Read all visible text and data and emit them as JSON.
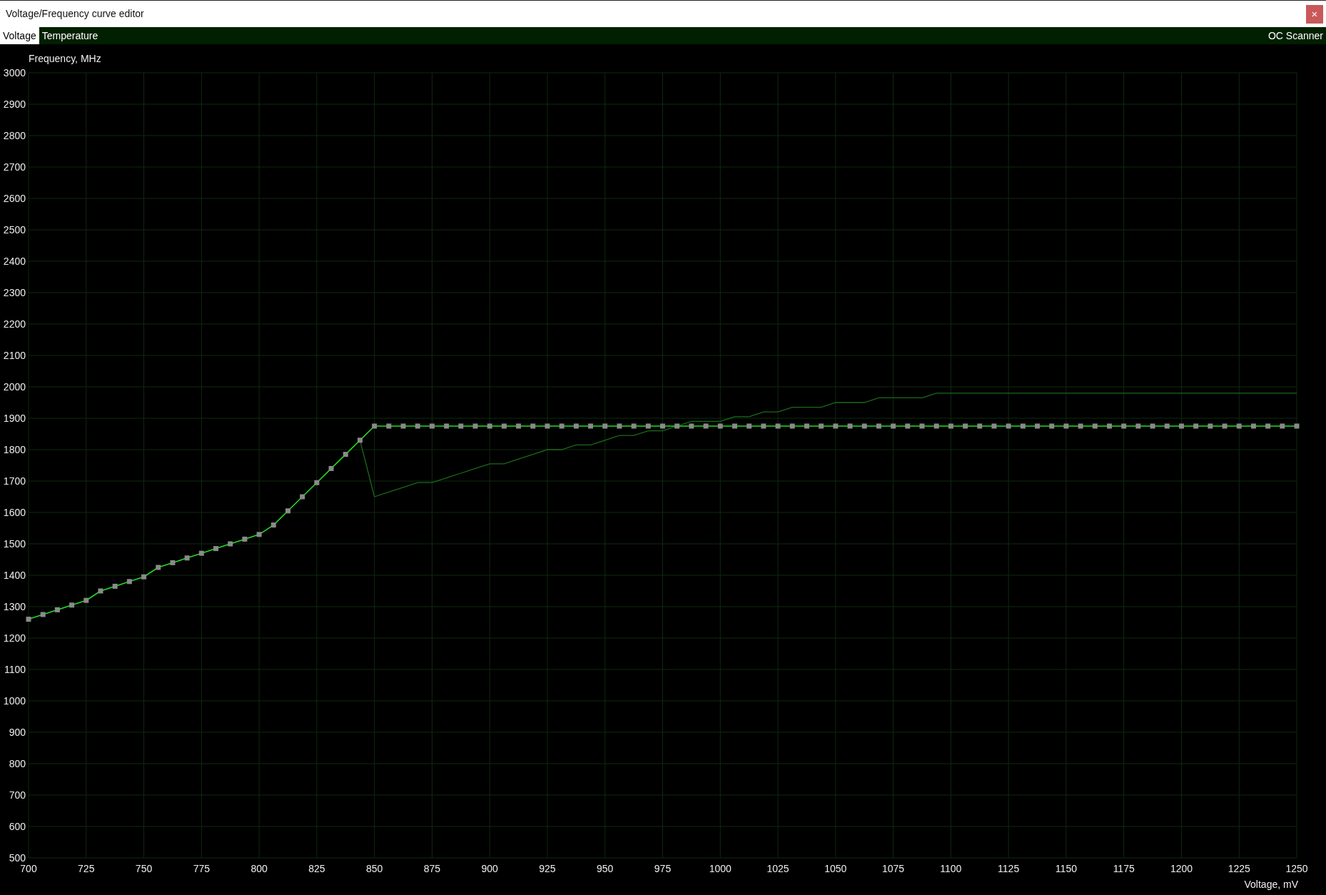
{
  "window": {
    "title": "Voltage/Frequency curve editor",
    "close": "×"
  },
  "tabs": [
    {
      "label": "Voltage",
      "selected": true
    },
    {
      "label": "Temperature",
      "selected": false
    }
  ],
  "oc_scanner": "OC Scanner",
  "chart": {
    "chart_data": {
      "type": "line",
      "grid": true,
      "xlabel": "Voltage, mV",
      "ylabel": "Frequency, MHz",
      "xlim": [
        700,
        1250
      ],
      "ylim": [
        500,
        3000
      ],
      "xticks": [
        700,
        725,
        750,
        775,
        800,
        825,
        850,
        875,
        900,
        925,
        950,
        975,
        1000,
        1025,
        1050,
        1075,
        1100,
        1125,
        1150,
        1175,
        1200,
        1225,
        1250
      ],
      "yticks": [
        500,
        600,
        700,
        800,
        900,
        1000,
        1100,
        1200,
        1300,
        1400,
        1500,
        1600,
        1700,
        1800,
        1900,
        2000,
        2100,
        2200,
        2300,
        2400,
        2500,
        2600,
        2700,
        2800,
        2900,
        3000
      ],
      "x": [
        700,
        706.25,
        712.5,
        718.75,
        725,
        731.25,
        737.5,
        743.75,
        750,
        756.25,
        762.5,
        768.75,
        775,
        781.25,
        787.5,
        793.75,
        800,
        806.25,
        812.5,
        818.75,
        825,
        831.25,
        837.5,
        843.75,
        850,
        856.25,
        862.5,
        868.75,
        875,
        881.25,
        887.5,
        893.75,
        900,
        906.25,
        912.5,
        918.75,
        925,
        931.25,
        937.5,
        943.75,
        950,
        956.25,
        962.5,
        968.75,
        975,
        981.25,
        987.5,
        993.75,
        1000,
        1006.25,
        1012.5,
        1018.75,
        1025,
        1031.25,
        1037.5,
        1043.75,
        1050,
        1056.25,
        1062.5,
        1068.75,
        1075,
        1081.25,
        1087.5,
        1093.75,
        1100,
        1106.25,
        1112.5,
        1118.75,
        1125,
        1131.25,
        1137.5,
        1143.75,
        1150,
        1156.25,
        1162.5,
        1168.75,
        1175,
        1181.25,
        1187.5,
        1193.75,
        1200,
        1206.25,
        1212.5,
        1218.75,
        1225,
        1231.25,
        1237.5,
        1243.75,
        1250
      ],
      "series": [
        {
          "color": "#22dd22",
          "marker": "square",
          "values": [
            1260,
            1275,
            1290,
            1305,
            1320,
            1350,
            1365,
            1380,
            1395,
            1425,
            1440,
            1455,
            1470,
            1485,
            1500,
            1515,
            1530,
            1560,
            1605,
            1650,
            1695,
            1740,
            1785,
            1830,
            1875,
            1875,
            1875,
            1875,
            1875,
            1875,
            1875,
            1875,
            1875,
            1875,
            1875,
            1875,
            1875,
            1875,
            1875,
            1875,
            1875,
            1875,
            1875,
            1875,
            1875,
            1875,
            1875,
            1875,
            1875,
            1875,
            1875,
            1875,
            1875,
            1875,
            1875,
            1875,
            1875,
            1875,
            1875,
            1875,
            1875,
            1875,
            1875,
            1875,
            1875,
            1875,
            1875,
            1875,
            1875,
            1875,
            1875,
            1875,
            1875,
            1875,
            1875,
            1875,
            1875,
            1875,
            1875,
            1875,
            1875,
            1875,
            1875,
            1875,
            1875,
            1875,
            1875,
            1875,
            1875
          ]
        },
        {
          "color": "#1a6b1a",
          "values": [
            null,
            null,
            null,
            null,
            null,
            null,
            null,
            null,
            null,
            null,
            null,
            null,
            null,
            null,
            null,
            null,
            null,
            null,
            null,
            null,
            null,
            null,
            null,
            1830,
            1650,
            1665,
            1680,
            1695,
            1695,
            1710,
            1725,
            1740,
            1755,
            1755,
            1770,
            1785,
            1800,
            1800,
            1815,
            1815,
            1830,
            1845,
            1845,
            1860,
            1860,
            1875,
            1890,
            1890,
            1890,
            1905,
            1905,
            1920,
            1920,
            1935,
            1935,
            1935,
            1950,
            1950,
            1950,
            1965,
            1965,
            1965,
            1965,
            1980,
            1980,
            1980,
            1980,
            1980,
            1980,
            1980,
            1980,
            1980,
            1980,
            1980,
            1980,
            1980,
            1980,
            1980,
            1980,
            1980,
            1980,
            1980,
            1980,
            1980,
            1980,
            1980,
            1980,
            1980,
            1980
          ]
        }
      ]
    }
  }
}
